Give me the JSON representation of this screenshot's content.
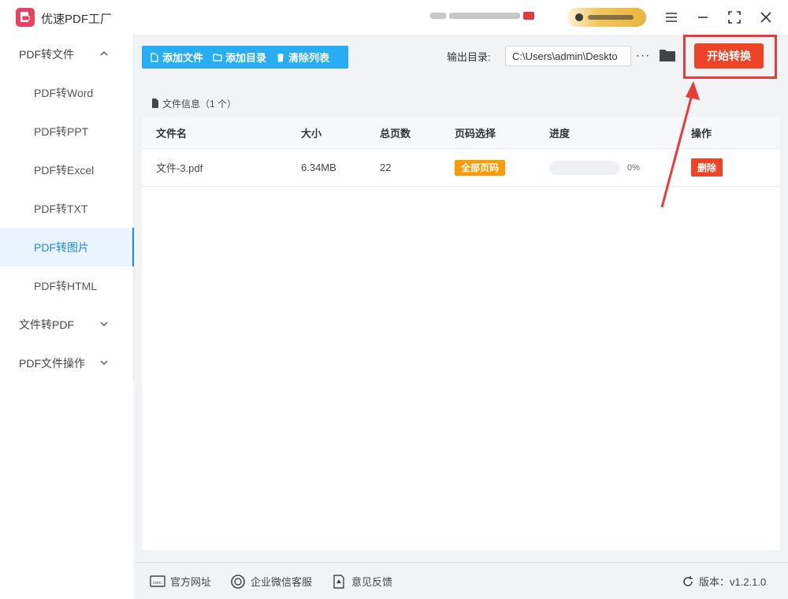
{
  "app": {
    "title": "优速PDF工厂"
  },
  "colors": {
    "accent": "#29adf2",
    "danger": "#ee4325",
    "tag": "#ff9a00",
    "annotation": "#ea3a3a"
  },
  "sidebar": {
    "groups": [
      {
        "label": "PDF转文件",
        "expanded": true
      },
      {
        "label": "文件转PDF",
        "expanded": false
      },
      {
        "label": "PDF文件操作",
        "expanded": false
      }
    ],
    "items": [
      "PDF转Word",
      "PDF转PPT",
      "PDF转Excel",
      "PDF转TXT",
      "PDF转图片",
      "PDF转HTML"
    ],
    "active_item": "PDF转图片"
  },
  "toolbar": {
    "add_file": "添加文件",
    "add_folder": "添加目录",
    "clear_list": "清除列表",
    "output_label": "输出目录:",
    "output_path": "C:\\Users\\admin\\Deskto",
    "more": "···",
    "start": "开始转换"
  },
  "file_panel": {
    "header": "文件信息（1 个）",
    "columns": [
      "文件名",
      "大小",
      "总页数",
      "页码选择",
      "进度",
      "操作"
    ],
    "rows": [
      {
        "name": "文件-3.pdf",
        "size": "6.34MB",
        "pages": "22",
        "page_select": "全部页码",
        "progress": 0,
        "progress_label": "0%",
        "action": "删除"
      }
    ]
  },
  "footer": {
    "website": "官方网址",
    "wechat": "企业微信客服",
    "feedback": "意见反馈",
    "version": "版本：v1.2.1.0"
  },
  "icons": [
    "app-logo-icon",
    "menu-icon",
    "minimize-icon",
    "maximize-icon",
    "close-icon",
    "chevron-up-icon",
    "chevron-down-icon",
    "file-icon",
    "folder-icon",
    "trash-icon",
    "document-icon",
    "website-icon",
    "wechat-icon",
    "feedback-icon",
    "refresh-icon",
    "arrow-annotation"
  ]
}
